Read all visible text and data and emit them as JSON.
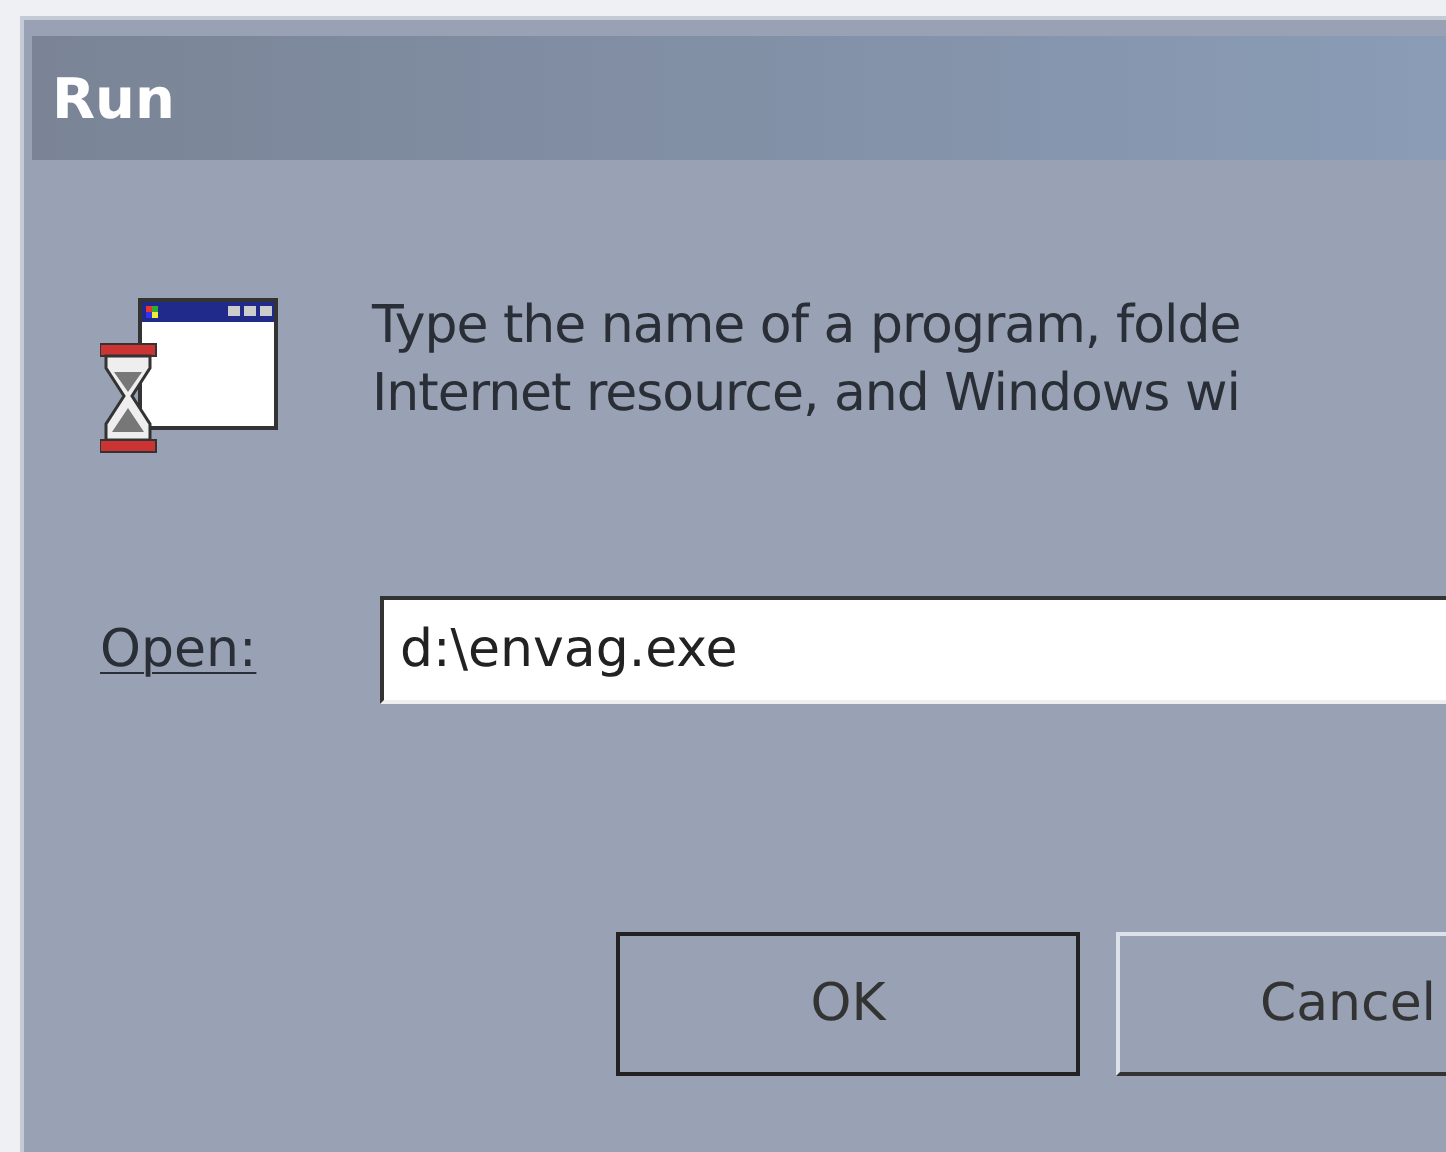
{
  "window": {
    "title": "Run"
  },
  "message": [
    "Type the name of a program, folde",
    "Internet resource, and Windows wi"
  ],
  "open_field": {
    "label": "Open:",
    "value": "d:\\envag.exe"
  },
  "buttons": [
    {
      "label": "OK",
      "default": true
    },
    {
      "label": "Cancel",
      "default": false
    }
  ]
}
